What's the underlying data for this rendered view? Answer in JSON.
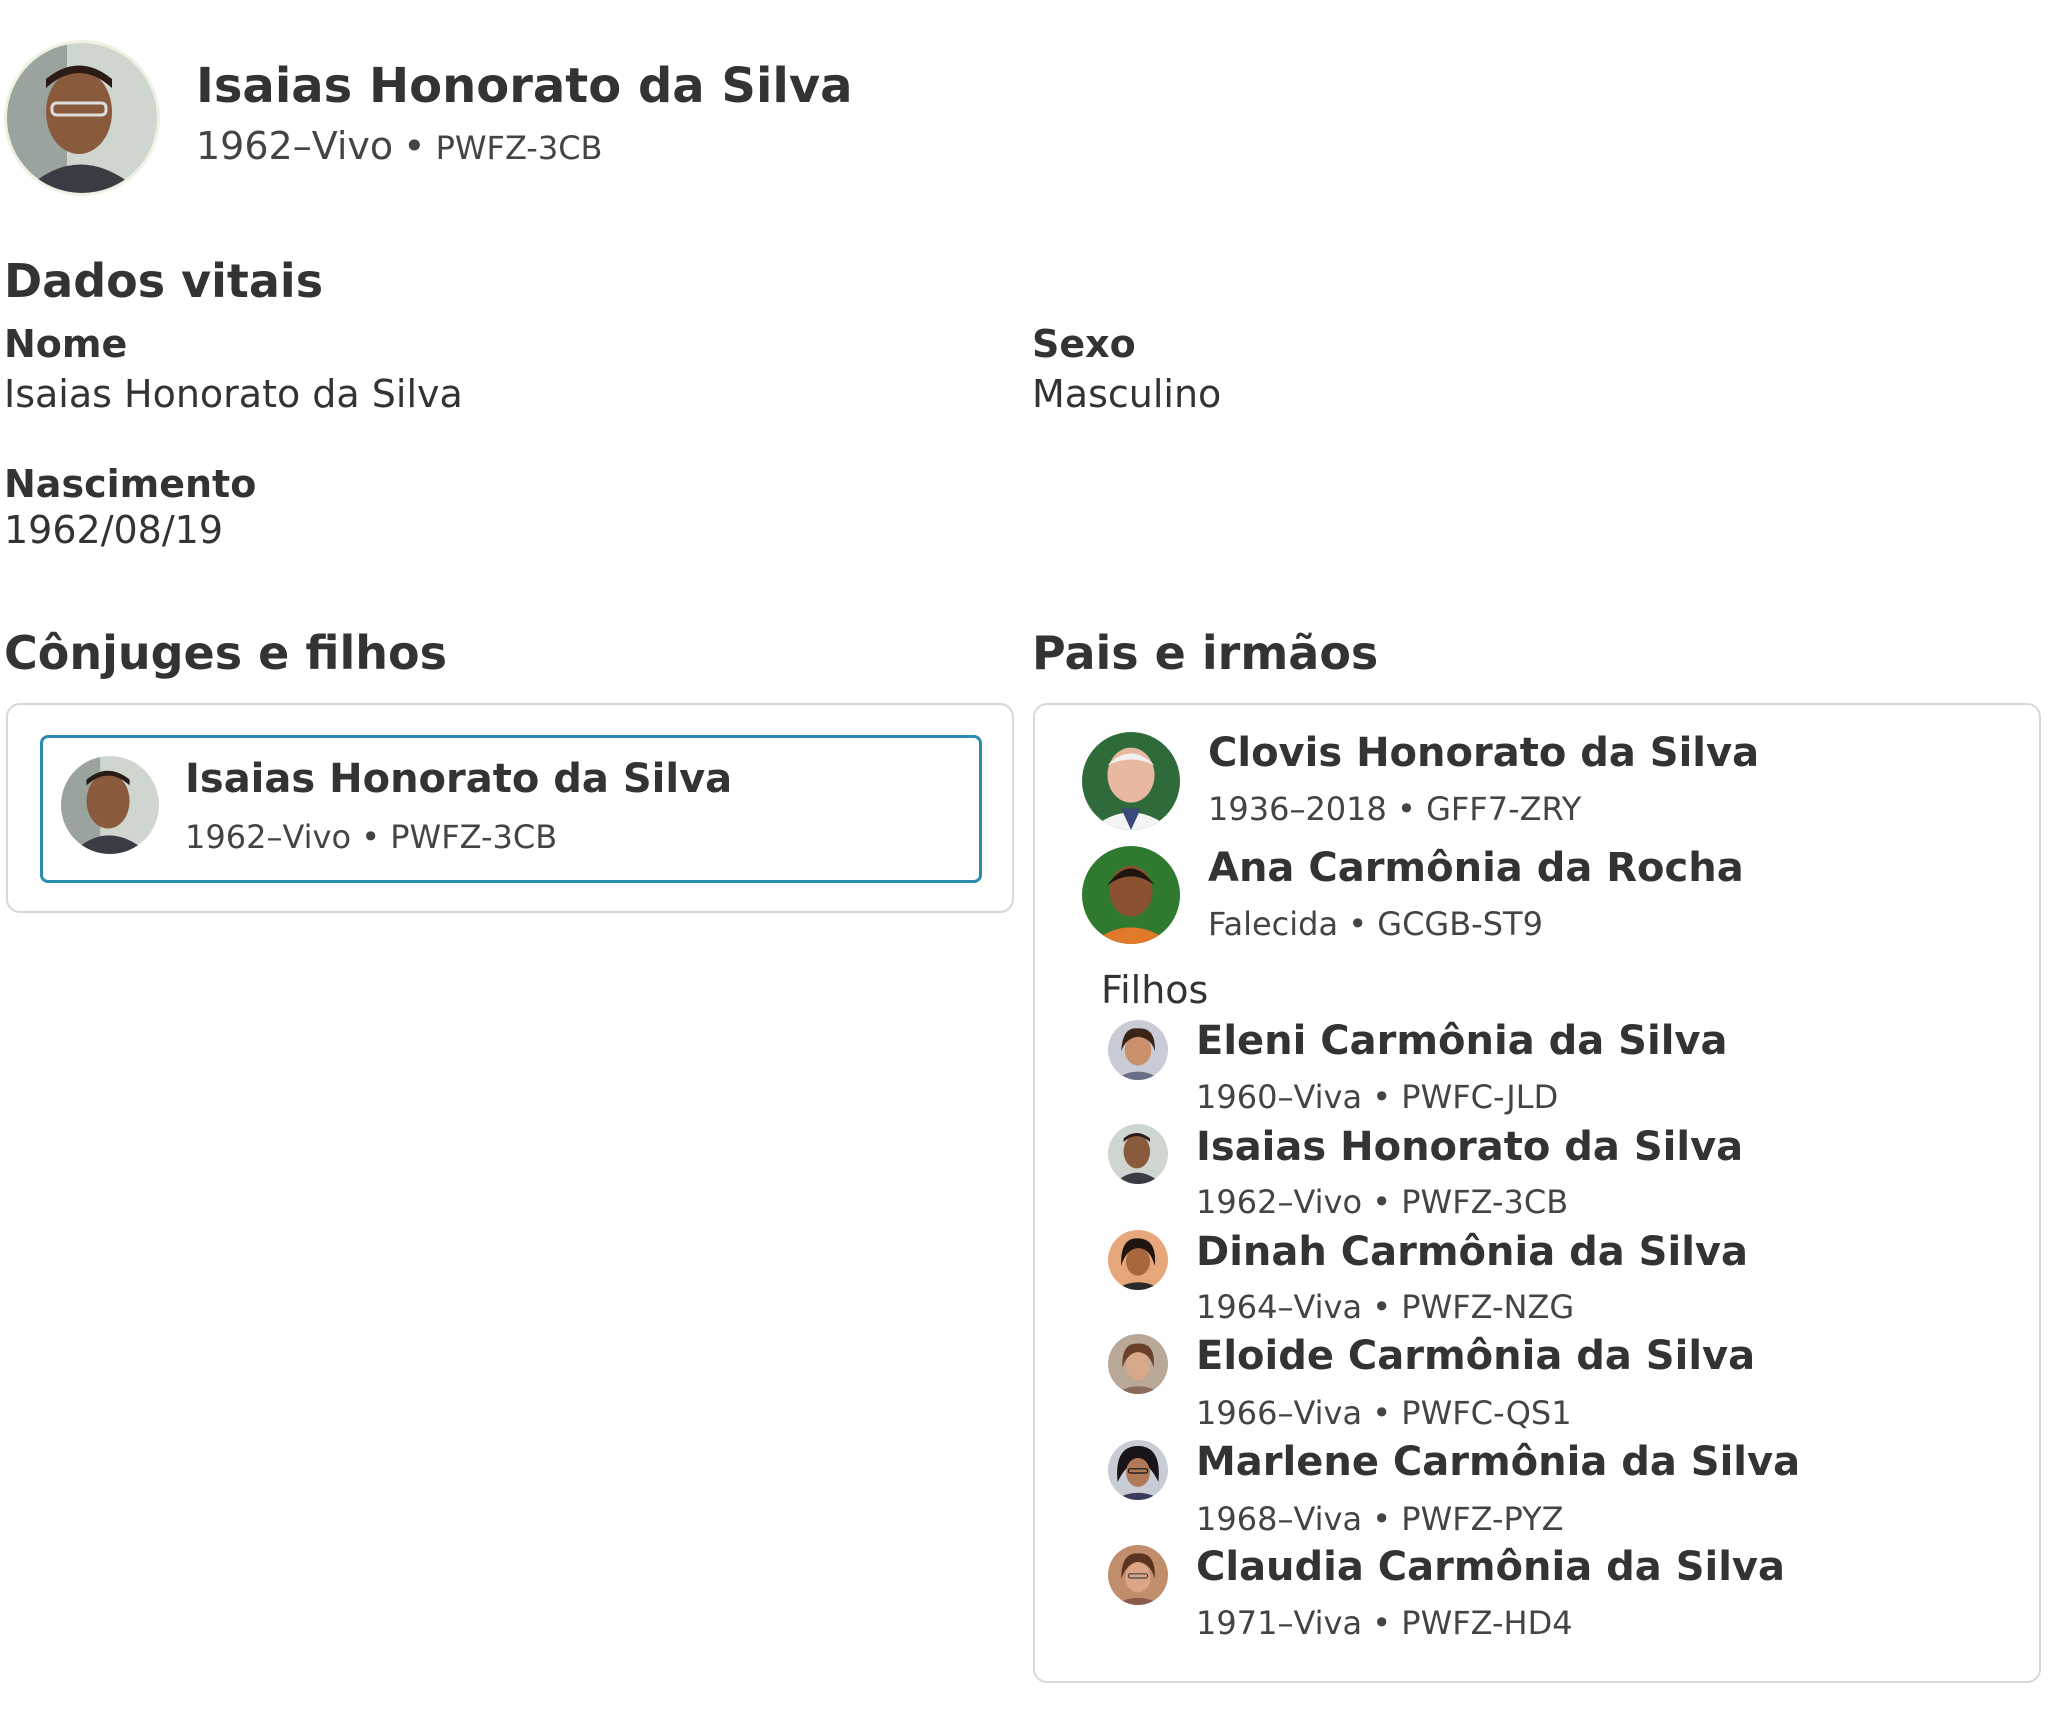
{
  "header": {
    "name": "Isaias Honorato da Silva",
    "lifespan": "1962–Vivo",
    "pid": "PWFZ-3CB"
  },
  "vitals": {
    "title": "Dados vitais",
    "name_label": "Nome",
    "name_value": "Isaias Honorato da Silva",
    "sex_label": "Sexo",
    "sex_value": "Masculino",
    "birth_label": "Nascimento",
    "birth_value": "1962/08/19"
  },
  "spouses": {
    "title": "Cônjuges e filhos",
    "person": {
      "name": "Isaias Honorato da Silva",
      "info": "1962–Vivo • PWFZ-3CB"
    }
  },
  "parents": {
    "title": "Pais e irmãos",
    "father": {
      "name": "Clovis Honorato da Silva",
      "info": "1936–2018 • GFF7-ZRY"
    },
    "mother": {
      "name": "Ana Carmônia da Rocha",
      "info": "Falecida • GCGB-ST9"
    },
    "children_label": "Filhos",
    "children": [
      {
        "name": "Eleni Carmônia da Silva",
        "info": "1960–Viva • PWFC-JLD"
      },
      {
        "name": "Isaias Honorato da Silva",
        "info": "1962–Vivo • PWFZ-3CB"
      },
      {
        "name": "Dinah Carmônia da Silva",
        "info": "1964–Viva • PWFZ-NZG"
      },
      {
        "name": "Eloide Carmônia da Silva",
        "info": "1966–Viva • PWFC-QS1"
      },
      {
        "name": "Marlene Carmônia da Silva",
        "info": "1968–Viva • PWFZ-PYZ"
      },
      {
        "name": "Claudia Carmônia da Silva",
        "info": "1971–Viva • PWFZ-HD4"
      }
    ]
  },
  "colors": {
    "accent_border": "#2b8cad",
    "card_border": "#d8d8d8",
    "text": "#333333"
  }
}
